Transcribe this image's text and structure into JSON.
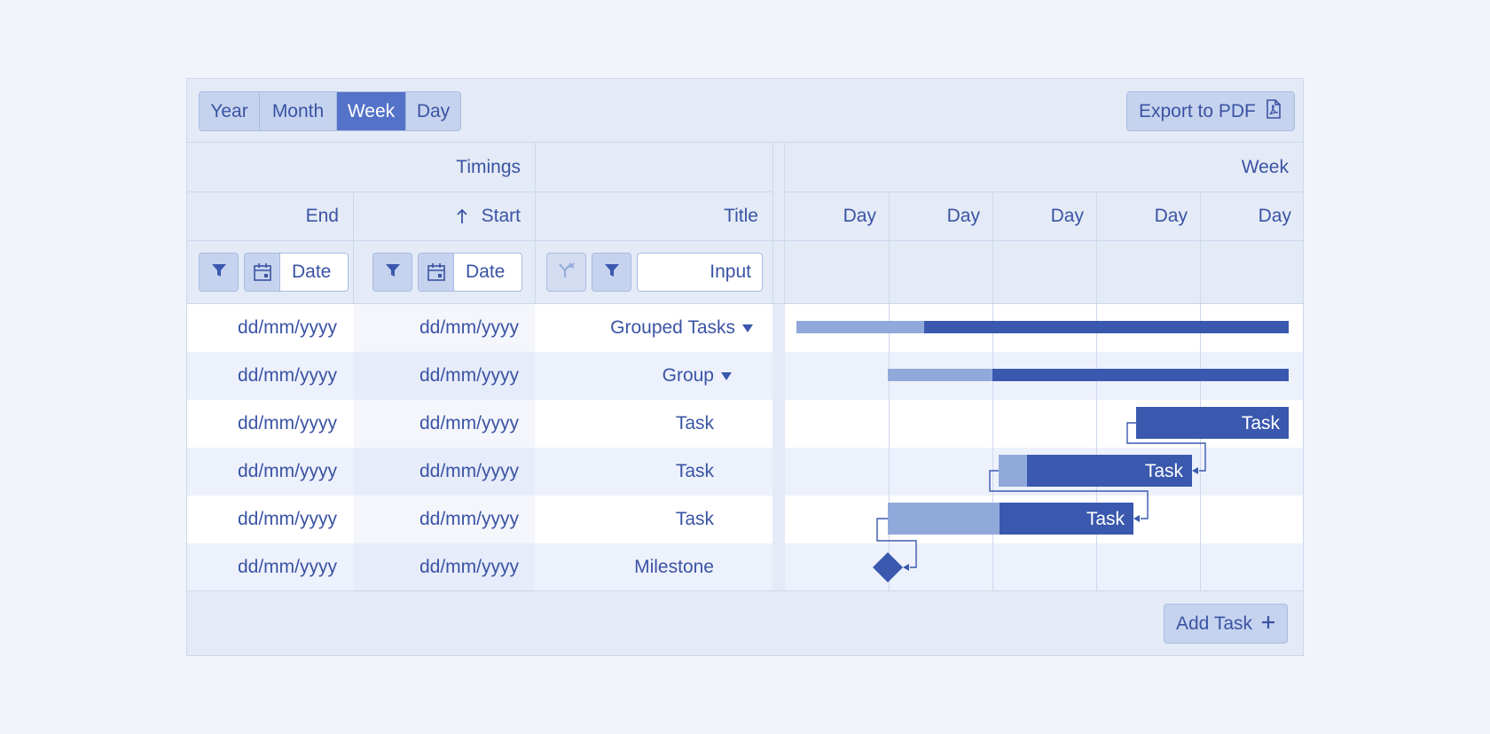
{
  "toolbar": {
    "view_modes": [
      "Year",
      "Month",
      "Week",
      "Day"
    ],
    "active_view": "Week",
    "export_label": "Export to PDF"
  },
  "columns": {
    "group_header": "Timings",
    "end_header": "End",
    "start_header": "Start",
    "title_header": "Title",
    "date_placeholder": "Date",
    "title_input_placeholder": "Input"
  },
  "timeline": {
    "period_header": "Week",
    "day_labels": [
      "Day",
      "Day",
      "Day",
      "Day",
      "Day"
    ]
  },
  "rows": [
    {
      "end": "dd/mm/yyyy",
      "start": "dd/mm/yyyy",
      "title": "Grouped Tasks",
      "expandable": true,
      "bar_label": ""
    },
    {
      "end": "dd/mm/yyyy",
      "start": "dd/mm/yyyy",
      "title": "Group",
      "expandable": true,
      "bar_label": ""
    },
    {
      "end": "dd/mm/yyyy",
      "start": "dd/mm/yyyy",
      "title": "Task",
      "expandable": false,
      "bar_label": "Task"
    },
    {
      "end": "dd/mm/yyyy",
      "start": "dd/mm/yyyy",
      "title": "Task",
      "expandable": false,
      "bar_label": "Task"
    },
    {
      "end": "dd/mm/yyyy",
      "start": "dd/mm/yyyy",
      "title": "Task",
      "expandable": false,
      "bar_label": "Task"
    },
    {
      "end": "dd/mm/yyyy",
      "start": "dd/mm/yyyy",
      "title": "Milestone",
      "expandable": false,
      "bar_label": ""
    }
  ],
  "footer": {
    "add_task_label": "Add Task"
  },
  "colors": {
    "accent": "#5472c7",
    "bar_dark": "#3a58ae",
    "bar_light": "#90a9da",
    "text": "#3a53a4"
  },
  "icons": {
    "filter": "filter-icon",
    "calendar": "calendar-icon",
    "sort_asc": "arrow-up-icon",
    "pdf": "pdf-icon",
    "plus": "plus-icon",
    "expand": "caret-down-icon",
    "clear_filter": "clear-filter-icon"
  }
}
